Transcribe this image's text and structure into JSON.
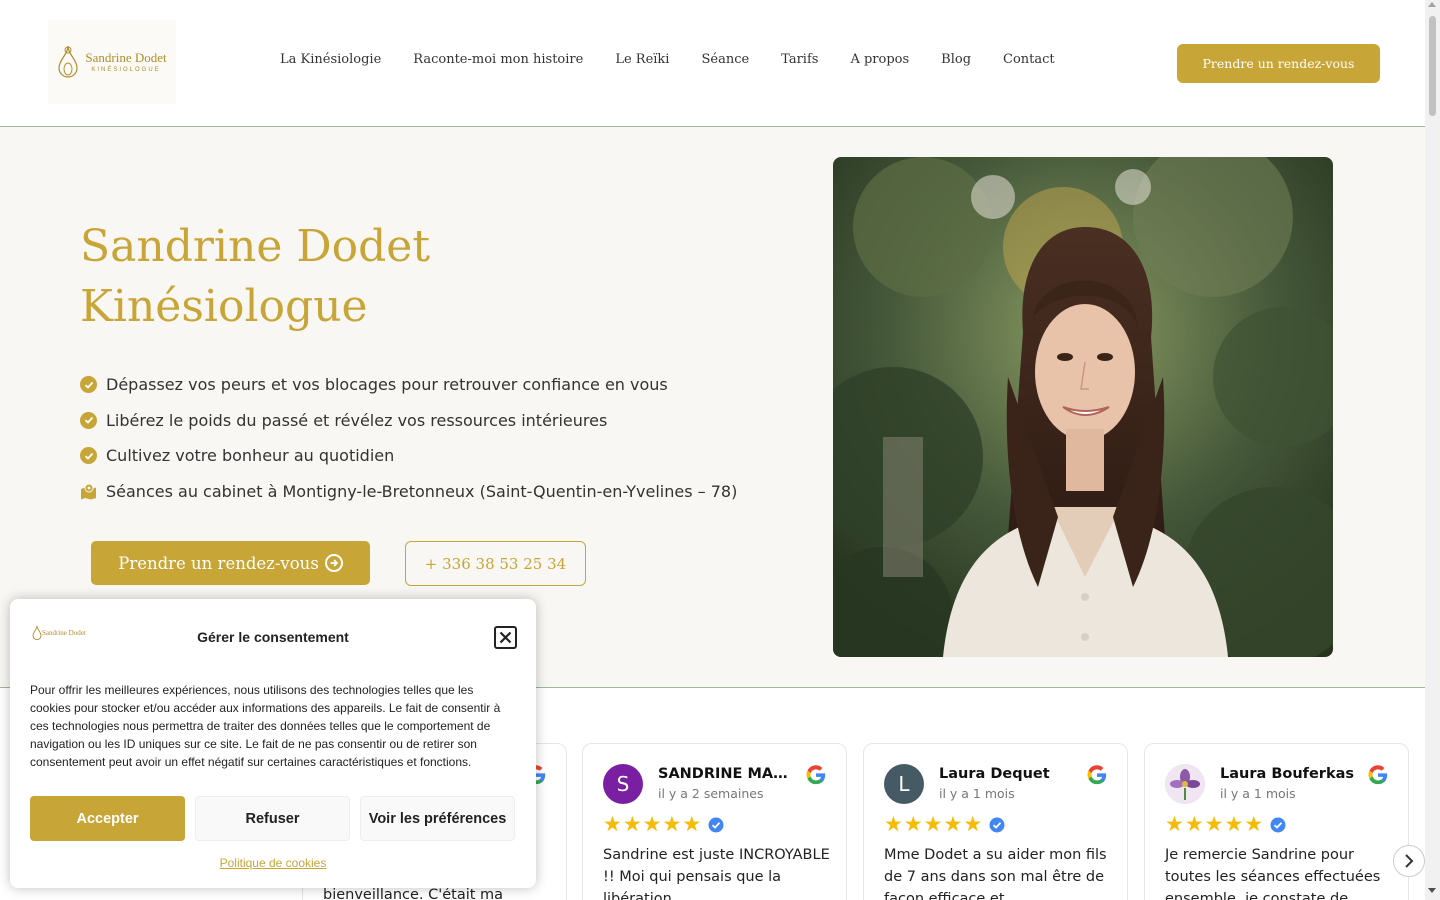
{
  "header": {
    "logo": {
      "name": "Sandrine Dodet",
      "subtitle": "KINÉSIOLOGUE"
    },
    "nav": [
      {
        "label": "La Kinésiologie"
      },
      {
        "label": "Raconte-moi mon histoire"
      },
      {
        "label": "Le Reïki"
      },
      {
        "label": "Séance"
      },
      {
        "label": "Tarifs"
      },
      {
        "label": "A propos"
      },
      {
        "label": "Blog"
      },
      {
        "label": "Contact"
      }
    ],
    "cta_label": "Prendre un rendez-vous"
  },
  "hero": {
    "title_line1": "Sandrine Dodet",
    "title_line2": "Kinésiologue",
    "bullets": [
      {
        "text": "Dépassez vos peurs et vos blocages pour retrouver confiance en vous",
        "icon": "check-circle-icon"
      },
      {
        "text": "Libérez le poids du passé et révélez vos ressources intérieures",
        "icon": "check-circle-icon"
      },
      {
        "text": "Cultivez votre bonheur au quotidien",
        "icon": "check-circle-icon"
      },
      {
        "text": "Séances au cabinet à Montigny-le-Bretonneux (Saint-Quentin-en-Yvelines – 78)",
        "icon": "map-marker-icon"
      }
    ],
    "cta_label": "Prendre un rendez-vous",
    "phone_label": "+ 336 38 53 25 34"
  },
  "reviews": {
    "items": [
      {
        "name": "SANDRINE MARTI...",
        "time": "il y a 2 semaines",
        "initial": "S",
        "avatar_color": "#7b1fa2",
        "rating": 5,
        "text": "Sandrine est juste INCROYABLE !! Moi qui pensais que la libération"
      },
      {
        "name": "Laura Dequet",
        "time": "il y a 1 mois",
        "initial": "L",
        "avatar_color": "#455a64",
        "rating": 5,
        "text": "Mme Dodet a su aider mon fils de 7 ans dans son mal être de façon efficace et"
      },
      {
        "name": "Laura Bouferkas",
        "time": "il y a 1 mois",
        "initial": "",
        "avatar_color": "#d9c8e6",
        "rating": 5,
        "text": "Je remercie Sandrine pour toutes les séances effectuées ensemble, je constate de"
      }
    ],
    "partial_text": "bienveillance. C'était ma"
  },
  "consent": {
    "logo_name": "Sandrine Dodet",
    "title": "Gérer le consentement",
    "text": "Pour offrir les meilleures expériences, nous utilisons des technologies telles que les cookies pour stocker et/ou accéder aux informations des appareils. Le fait de consentir à ces technologies nous permettra de traiter des données telles que le comportement de navigation ou les ID uniques sur ce site. Le fait de ne pas consentir ou de retirer son consentement peut avoir un effet négatif sur certaines caractéristiques et fonctions.",
    "accept_label": "Accepter",
    "refuse_label": "Refuser",
    "prefs_label": "Voir les préférences",
    "policy_label": "Politique de cookies"
  },
  "colors": {
    "accent": "#c8a537",
    "hero_bg": "#f8f7f4",
    "divider": "#9db79c",
    "star": "#f6bb06"
  }
}
